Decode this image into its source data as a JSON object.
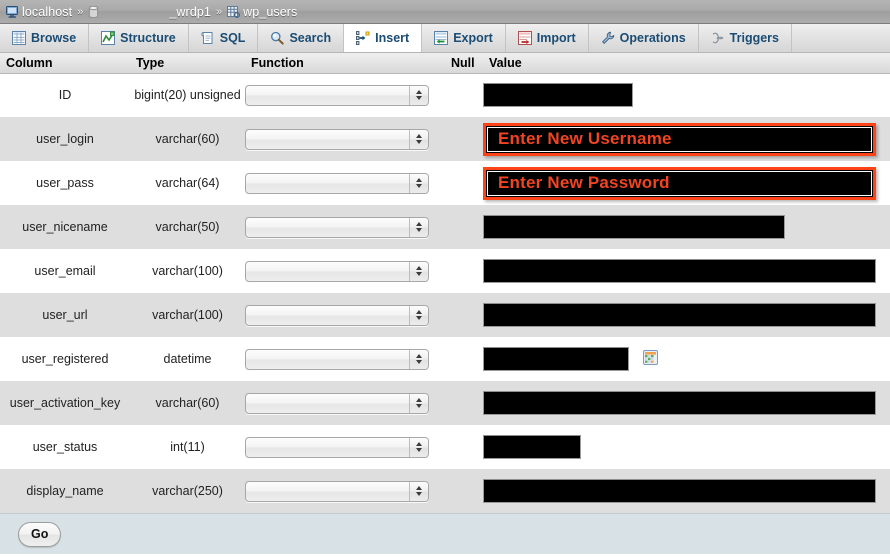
{
  "breadcrumb": {
    "server": "localhost",
    "separator": "»",
    "database": "_wrdp1",
    "table": "wp_users",
    "server_icon": "server-icon",
    "database_icon": "database-icon",
    "table_icon": "table-icon"
  },
  "tabs": [
    {
      "label": "Browse",
      "icon": "browse-icon",
      "active": false
    },
    {
      "label": "Structure",
      "icon": "structure-icon",
      "active": false
    },
    {
      "label": "SQL",
      "icon": "sql-icon",
      "active": false
    },
    {
      "label": "Search",
      "icon": "search-icon",
      "active": false
    },
    {
      "label": "Insert",
      "icon": "insert-icon",
      "active": true
    },
    {
      "label": "Export",
      "icon": "export-icon",
      "active": false
    },
    {
      "label": "Import",
      "icon": "import-icon",
      "active": false
    },
    {
      "label": "Operations",
      "icon": "operations-icon",
      "active": false
    },
    {
      "label": "Triggers",
      "icon": "triggers-icon",
      "active": false
    }
  ],
  "table_headers": {
    "column": "Column",
    "type": "Type",
    "function": "Function",
    "null": "Null",
    "value": "Value"
  },
  "rows": [
    {
      "column": "ID",
      "type": "bigint(20) unsigned",
      "function": "",
      "null": "",
      "value": "",
      "value_style": "w-id",
      "highlight": false,
      "calendar": false
    },
    {
      "column": "user_login",
      "type": "varchar(60)",
      "function": "",
      "null": "",
      "value": "Enter New Username",
      "value_style": "w-full",
      "highlight": true,
      "calendar": false
    },
    {
      "column": "user_pass",
      "type": "varchar(64)",
      "function": "",
      "null": "",
      "value": "Enter New Password",
      "value_style": "w-full",
      "highlight": true,
      "calendar": false
    },
    {
      "column": "user_nicename",
      "type": "varchar(50)",
      "function": "",
      "null": "",
      "value": "",
      "value_style": "w-nice",
      "highlight": false,
      "calendar": false
    },
    {
      "column": "user_email",
      "type": "varchar(100)",
      "function": "",
      "null": "",
      "value": "",
      "value_style": "w-full",
      "highlight": false,
      "calendar": false
    },
    {
      "column": "user_url",
      "type": "varchar(100)",
      "function": "",
      "null": "",
      "value": "",
      "value_style": "w-full",
      "highlight": false,
      "calendar": false
    },
    {
      "column": "user_registered",
      "type": "datetime",
      "function": "",
      "null": "",
      "value": "",
      "value_style": "w-date",
      "highlight": false,
      "calendar": true
    },
    {
      "column": "user_activation_key",
      "type": "varchar(60)",
      "function": "",
      "null": "",
      "value": "",
      "value_style": "w-full",
      "highlight": false,
      "calendar": false
    },
    {
      "column": "user_status",
      "type": "int(11)",
      "function": "",
      "null": "",
      "value": "",
      "value_style": "w-stat",
      "highlight": false,
      "calendar": false
    },
    {
      "column": "display_name",
      "type": "varchar(250)",
      "function": "",
      "null": "",
      "value": "",
      "value_style": "w-full",
      "highlight": false,
      "calendar": false
    }
  ],
  "footer": {
    "go_label": "Go"
  },
  "colors": {
    "highlight_border": "#ff4318",
    "highlight_text": "#f04423",
    "tab_text": "#1b4c74",
    "header_link": "#235a8a",
    "row_even_bg": "#dedede",
    "footer_bg": "#d7e1e6"
  }
}
